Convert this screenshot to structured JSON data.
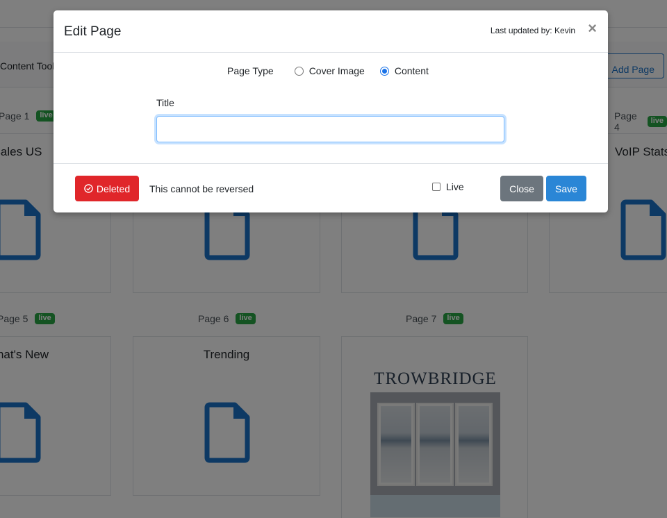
{
  "background": {
    "content_tools_label": "Content Tools",
    "add_page_label": "Add Page",
    "pages": [
      {
        "label": "Page 1",
        "badge": "live",
        "title": "Sales US"
      },
      {
        "label": "Page 4",
        "badge": "live",
        "title": "VoIP Stats"
      },
      {
        "label": "Page 5",
        "badge": "live",
        "title": "What's New"
      },
      {
        "label": "Page 6",
        "badge": "live",
        "title": "Trending"
      },
      {
        "label": "Page 7",
        "badge": "live",
        "cover_brand": "TROWBRIDGE"
      }
    ],
    "icon_color": "#1a73c9"
  },
  "modal": {
    "title": "Edit Page",
    "last_updated": "Last updated by: Kevin",
    "close_icon": "×",
    "page_type_label": "Page Type",
    "page_type_options": [
      {
        "label": "Cover Image",
        "checked": false
      },
      {
        "label": "Content",
        "checked": true
      }
    ],
    "title_label": "Title",
    "title_value": "",
    "deleted_label": "Deleted",
    "warning_text": "This cannot be reversed",
    "live_label": "Live",
    "live_checked": false,
    "close_label": "Close",
    "save_label": "Save"
  },
  "colors": {
    "danger": "#e0262a",
    "primary": "#2a86d6",
    "secondary": "#6c757d",
    "success": "#28a745"
  }
}
